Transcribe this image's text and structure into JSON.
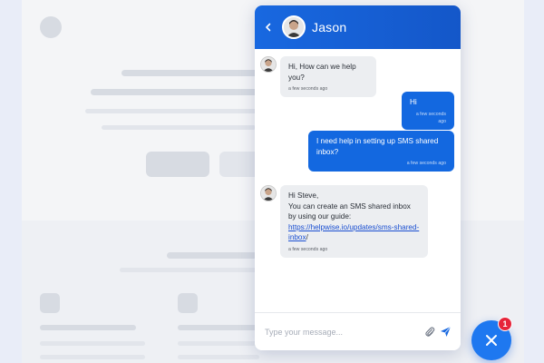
{
  "header": {
    "agent_name": "Jason",
    "back_icon": "chevron-left-icon",
    "accent_color": "#1868e0"
  },
  "messages": [
    {
      "direction": "in",
      "text": "Hi, How can we help you?",
      "time": "a few seconds ago"
    },
    {
      "direction": "out",
      "text": "Hi",
      "time": "a few seconds ago"
    },
    {
      "direction": "out",
      "text": "I need help in setting up SMS shared inbox?",
      "time": "a few seconds ago"
    },
    {
      "direction": "in",
      "text_line1": "Hi Steve,",
      "text_line2": "You can create an SMS shared inbox by using our guide:",
      "link": "https://helpwise.io/updates/sms-shared-inbox",
      "link_suffix": "/",
      "time": "a few seconds ago"
    }
  ],
  "composer": {
    "placeholder": "Type your message...",
    "attach_icon": "paperclip-icon",
    "send_icon": "send-icon"
  },
  "launcher": {
    "icon": "close-icon",
    "badge_count": "1",
    "color": "#1e78f0",
    "badge_color": "#e6253a"
  }
}
